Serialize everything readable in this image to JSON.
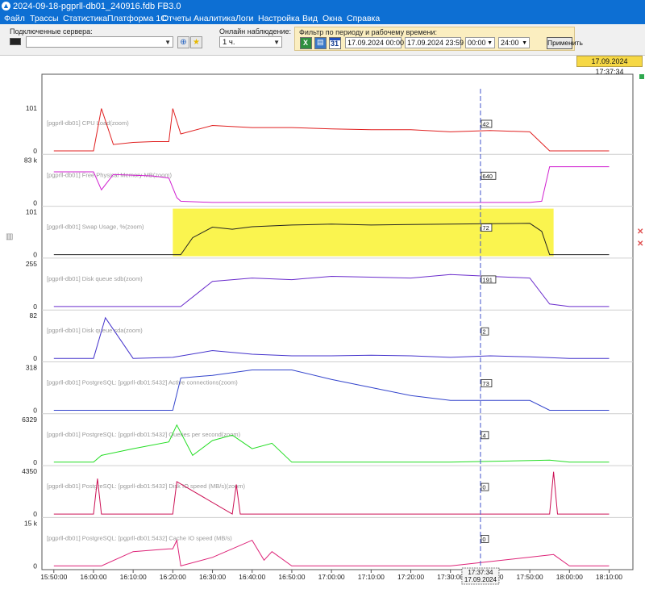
{
  "window": {
    "title": "2024-09-18-pgprll-db01_240916.fdb  FB3.0"
  },
  "menu": [
    "Файл",
    "Трассы",
    "Статистика",
    "Платформа 1С",
    "Отчеты",
    "Аналитика",
    "Логи",
    "Настройка",
    "Вид",
    "Окна",
    "Справка"
  ],
  "toolbar": {
    "servers_label": "Подключенные сервера:",
    "servers_value": "",
    "online_label": "Онлайн наблюдение:",
    "online_value": "1 ч.",
    "filter_label": "Фильтр по периоду и рабочему времени:",
    "calendar_day": "31",
    "date_from": "17.09.2024 00:00",
    "date_to": "17.09.2024 23:59",
    "work_from": "00:00",
    "work_to": "24:00",
    "apply_label": "Применить"
  },
  "current_time_badge": "17.09.2024 17:37:34",
  "cursor": {
    "time": "17:37:34",
    "date": "17.09.2024"
  },
  "colors": {
    "titlebar": "#0d6fd3",
    "highlight": "#f9f230",
    "cursor_line": "#4455cc"
  },
  "icons": [
    "app-icon",
    "monitor-icon",
    "connect-icon",
    "favorite-star-icon",
    "excel-icon",
    "table-icon",
    "calendar-icon",
    "chevron-down-icon",
    "side-chart-icon",
    "close-icon"
  ],
  "chart_data": [
    {
      "type": "line",
      "title": "[pgprll-db01] CPU Load(zoom)",
      "ylim": [
        0,
        101
      ],
      "ytop_label": "101",
      "ybottom_label": "0",
      "cursor_value": "42",
      "color": "#e02020",
      "x": [
        "15:50",
        "16:00",
        "16:02",
        "16:05",
        "16:10",
        "16:15",
        "16:19",
        "16:20",
        "16:22",
        "16:30",
        "16:40",
        "16:50",
        "17:00",
        "17:10",
        "17:20",
        "17:30",
        "17:40",
        "17:50",
        "17:55",
        "18:00",
        "18:10"
      ],
      "y": [
        0,
        0,
        100,
        15,
        20,
        22,
        22,
        100,
        40,
        60,
        55,
        55,
        52,
        50,
        50,
        45,
        48,
        45,
        0,
        0,
        0
      ]
    },
    {
      "type": "line",
      "title": "[pgprll-db01] Free Physical Memory MB(zoom)",
      "ylim": [
        0,
        83000
      ],
      "ytop_label": "83 k",
      "ybottom_label": "0",
      "cursor_value": "640",
      "color": "#d020d0",
      "x": [
        "15:50",
        "16:00",
        "16:02",
        "16:05",
        "16:15",
        "16:19",
        "16:21",
        "16:22",
        "16:30",
        "16:40",
        "16:50",
        "17:00",
        "17:10",
        "17:20",
        "17:30",
        "17:40",
        "17:50",
        "17:53",
        "17:55",
        "18:00",
        "18:10"
      ],
      "y": [
        60000,
        60000,
        25000,
        55000,
        52000,
        48000,
        10000,
        3000,
        600,
        600,
        600,
        600,
        600,
        600,
        640,
        640,
        640,
        3000,
        70000,
        70000,
        70000
      ]
    },
    {
      "type": "line",
      "title": "[pgprll-db01] Swap Usage, %(zoom)",
      "ylim": [
        0,
        101
      ],
      "ytop_label": "101",
      "ybottom_label": "0",
      "cursor_value": "72",
      "color": "#222222",
      "highlight": true,
      "x": [
        "15:50",
        "16:00",
        "16:10",
        "16:20",
        "16:22",
        "16:25",
        "16:30",
        "16:35",
        "16:40",
        "16:50",
        "17:00",
        "17:10",
        "17:20",
        "17:30",
        "17:40",
        "17:50",
        "17:53",
        "17:55",
        "18:00",
        "18:10"
      ],
      "y": [
        0,
        0,
        0,
        0,
        0,
        40,
        65,
        60,
        66,
        70,
        72,
        70,
        71,
        72,
        73,
        74,
        55,
        0,
        0,
        0
      ]
    },
    {
      "type": "line",
      "title": "[pgprll-db01] Disk queue sdb(zoom)",
      "ylim": [
        0,
        255
      ],
      "ytop_label": "255",
      "ybottom_label": "0",
      "cursor_value": "191",
      "color": "#6a2ccc",
      "x": [
        "15:50",
        "16:00",
        "16:10",
        "16:22",
        "16:30",
        "16:40",
        "16:50",
        "17:00",
        "17:10",
        "17:20",
        "17:30",
        "17:40",
        "17:50",
        "17:55",
        "18:00",
        "18:10"
      ],
      "y": [
        0,
        0,
        0,
        0,
        150,
        170,
        160,
        180,
        175,
        170,
        191,
        180,
        170,
        15,
        0,
        0
      ]
    },
    {
      "type": "line",
      "title": "[pgprll-db01] Disk queue sda(zoom)",
      "ylim": [
        0,
        82
      ],
      "ytop_label": "82",
      "ybottom_label": "0",
      "cursor_value": "2",
      "color": "#4433cc",
      "x": [
        "15:50",
        "16:00",
        "16:03",
        "16:10",
        "16:20",
        "16:30",
        "16:40",
        "16:50",
        "17:00",
        "17:10",
        "17:20",
        "17:30",
        "17:40",
        "17:50",
        "18:00",
        "18:10"
      ],
      "y": [
        0,
        0,
        78,
        0,
        2,
        15,
        8,
        5,
        5,
        6,
        5,
        2,
        5,
        3,
        0,
        0
      ]
    },
    {
      "type": "line",
      "title": "[pgprll-db01] PostgreSQL: [pgprll-db01:5432] Active connections(zoom)",
      "ylim": [
        0,
        318
      ],
      "ytop_label": "318",
      "ybottom_label": "0",
      "cursor_value": "73",
      "color": "#3344cc",
      "x": [
        "15:50",
        "16:00",
        "16:10",
        "16:20",
        "16:22",
        "16:30",
        "16:40",
        "16:50",
        "17:00",
        "17:10",
        "17:20",
        "17:30",
        "17:40",
        "17:50",
        "17:55",
        "18:00",
        "18:10"
      ],
      "y": [
        0,
        0,
        0,
        0,
        240,
        260,
        300,
        300,
        230,
        170,
        110,
        73,
        73,
        73,
        0,
        0,
        0
      ]
    },
    {
      "type": "line",
      "title": "[pgprll-db01] PostgreSQL: [pgprll-db01:5432] Queries per second(zoom)",
      "ylim": [
        0,
        6329
      ],
      "ytop_label": "6329",
      "ybottom_label": "0",
      "cursor_value": "4",
      "color": "#22dd22",
      "x": [
        "15:50",
        "16:00",
        "16:02",
        "16:10",
        "16:19",
        "16:21",
        "16:25",
        "16:30",
        "16:35",
        "16:40",
        "16:45",
        "16:50",
        "17:00",
        "17:30",
        "17:55",
        "18:00",
        "18:10"
      ],
      "y": [
        0,
        0,
        1000,
        2000,
        3000,
        5500,
        1000,
        3200,
        4000,
        2000,
        2800,
        0,
        0,
        4,
        300,
        0,
        0
      ]
    },
    {
      "type": "line",
      "title": "[pgprll-db01] PostgreSQL: [pgprll-db01:5432] Disk IO speed (MB/s)(zoom)",
      "ylim": [
        0,
        4350
      ],
      "ytop_label": "4350",
      "ybottom_label": "0",
      "cursor_value": "0",
      "color": "#cc1155",
      "x": [
        "15:50",
        "16:00",
        "16:01",
        "16:02",
        "16:05",
        "16:20",
        "16:21",
        "16:35",
        "16:36",
        "16:37",
        "17:30",
        "17:55",
        "17:56",
        "17:57",
        "18:00",
        "18:10"
      ],
      "y": [
        0,
        0,
        3600,
        0,
        0,
        0,
        3300,
        0,
        3000,
        0,
        0,
        0,
        4300,
        0,
        0,
        0
      ]
    },
    {
      "type": "line",
      "title": "[pgprll-db01] PostgreSQL: [pgprll-db01:5432] Cache IO speed (MB/s)",
      "ylim": [
        0,
        15000
      ],
      "ytop_label": "15 k",
      "ybottom_label": "0",
      "cursor_value": "0",
      "color": "#dd2277",
      "x": [
        "15:50",
        "16:00",
        "16:02",
        "16:10",
        "16:19",
        "16:20",
        "16:21",
        "16:22",
        "16:30",
        "16:40",
        "16:43",
        "16:45",
        "16:50",
        "17:30",
        "17:56",
        "18:00",
        "18:10"
      ],
      "y": [
        0,
        0,
        0,
        5000,
        6000,
        6000,
        9000,
        0,
        3000,
        9000,
        2000,
        5000,
        0,
        0,
        4000,
        0,
        0
      ]
    }
  ],
  "x_axis": {
    "ticks": [
      "15:50:00",
      "16:00:00",
      "16:10:00",
      "16:20:00",
      "16:30:00",
      "16:40:00",
      "16:50:00",
      "17:00:00",
      "17:10:00",
      "17:20:00",
      "17:30:00",
      "17:40:00",
      "17:50:00",
      "18:00:00",
      "18:10:00"
    ]
  }
}
